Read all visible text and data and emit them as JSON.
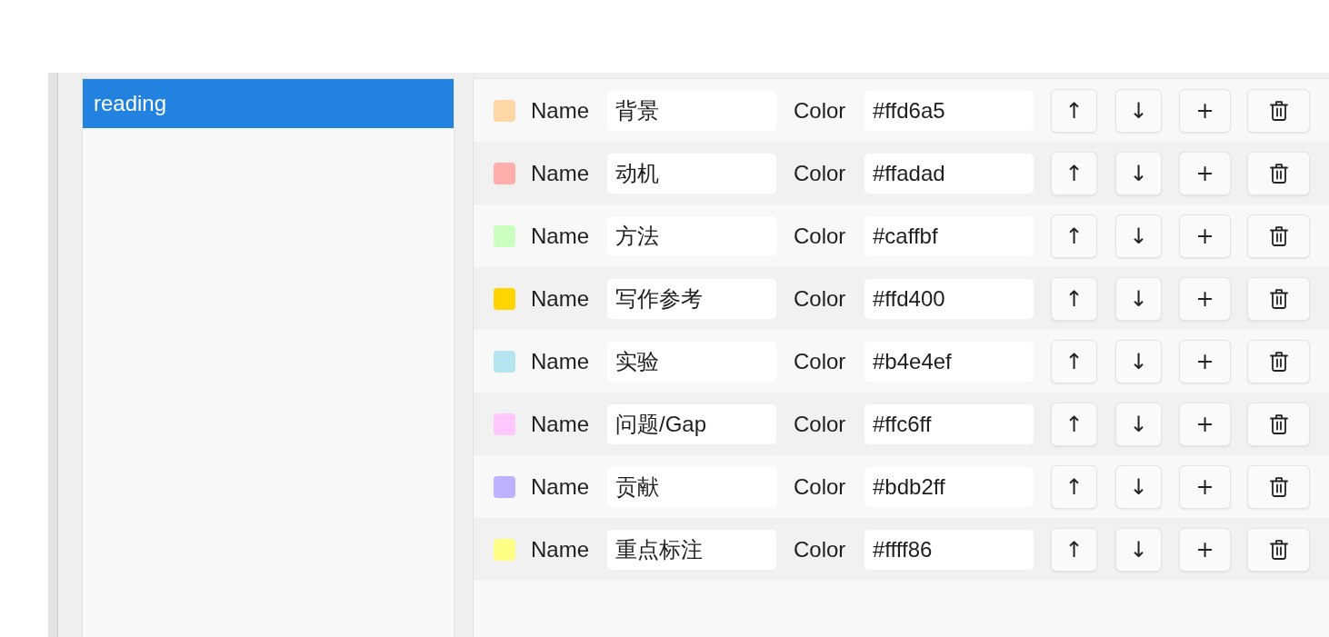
{
  "list": {
    "items": [
      {
        "label": "reading",
        "selected": true
      }
    ]
  },
  "categories": [
    {
      "color": "#ffd6a5",
      "name_label": "Name",
      "name": "背景",
      "color_label": "Color",
      "color_value": "#ffd6a5",
      "up": "↑",
      "down": "↓",
      "add": "+"
    },
    {
      "color": "#ffadad",
      "name_label": "Name",
      "name": "动机",
      "color_label": "Color",
      "color_value": "#ffadad",
      "up": "↑",
      "down": "↓",
      "add": "+"
    },
    {
      "color": "#caffbf",
      "name_label": "Name",
      "name": "方法",
      "color_label": "Color",
      "color_value": "#caffbf",
      "up": "↑",
      "down": "↓",
      "add": "+"
    },
    {
      "color": "#ffd400",
      "name_label": "Name",
      "name": "写作参考",
      "color_label": "Color",
      "color_value": "#ffd400",
      "up": "↑",
      "down": "↓",
      "add": "+"
    },
    {
      "color": "#b4e4ef",
      "name_label": "Name",
      "name": "实验",
      "color_label": "Color",
      "color_value": "#b4e4ef",
      "up": "↑",
      "down": "↓",
      "add": "+"
    },
    {
      "color": "#ffc6ff",
      "name_label": "Name",
      "name": "问题/Gap",
      "color_label": "Color",
      "color_value": "#ffc6ff",
      "up": "↑",
      "down": "↓",
      "add": "+"
    },
    {
      "color": "#bdb2ff",
      "name_label": "Name",
      "name": "贡献",
      "color_label": "Color",
      "color_value": "#bdb2ff",
      "up": "↑",
      "down": "↓",
      "add": "+"
    },
    {
      "color": "#ffff86",
      "name_label": "Name",
      "name": "重点标注",
      "color_label": "Color",
      "color_value": "#ffff86",
      "up": "↑",
      "down": "↓",
      "add": "+"
    }
  ]
}
